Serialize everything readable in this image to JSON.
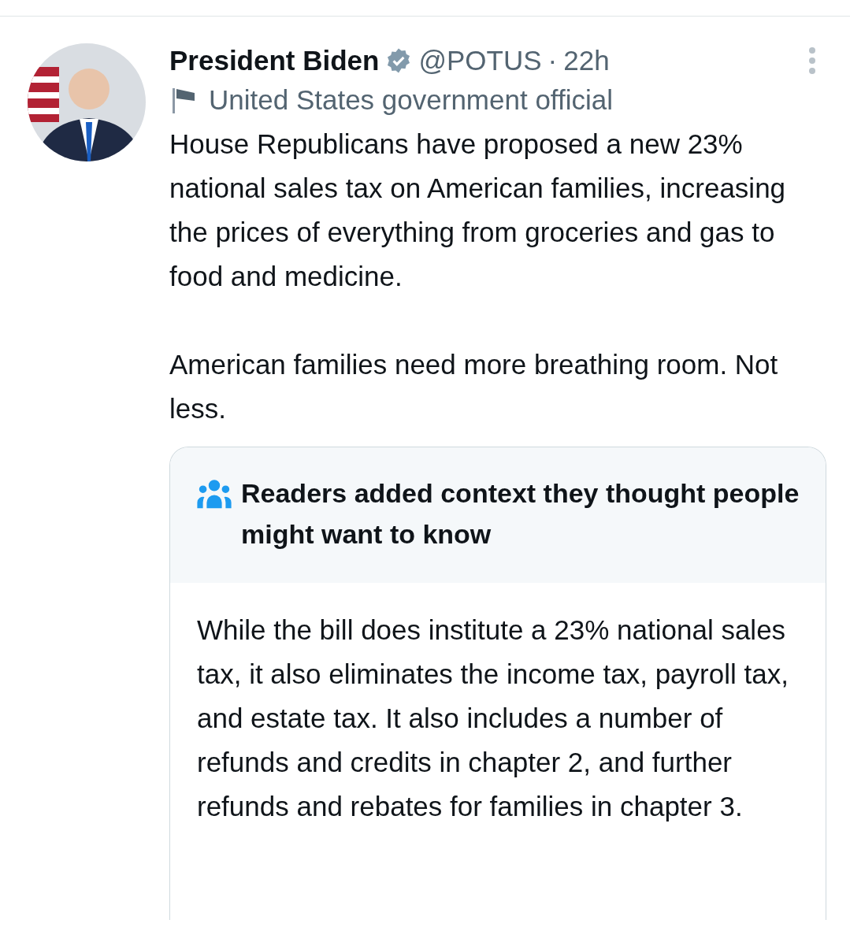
{
  "tweet": {
    "author": {
      "name": "President Biden",
      "verified": true,
      "handle": "@POTUS",
      "separator": "·",
      "time": "22h",
      "label": "United States government official"
    },
    "body": [
      "House Republicans have proposed a new 23% national sales tax on American families, increasing the prices of everything from groceries and gas to food and medicine.",
      "American families need more breathing room. Not less."
    ],
    "context": {
      "title": "Readers added context they thought people might want to know",
      "text": "While the bill does institute a 23% national sales tax, it also eliminates the income tax, payroll tax, and estate tax. It also includes a number of refunds and credits in chapter 2, and further refunds and rebates for families in chapter 3."
    }
  }
}
